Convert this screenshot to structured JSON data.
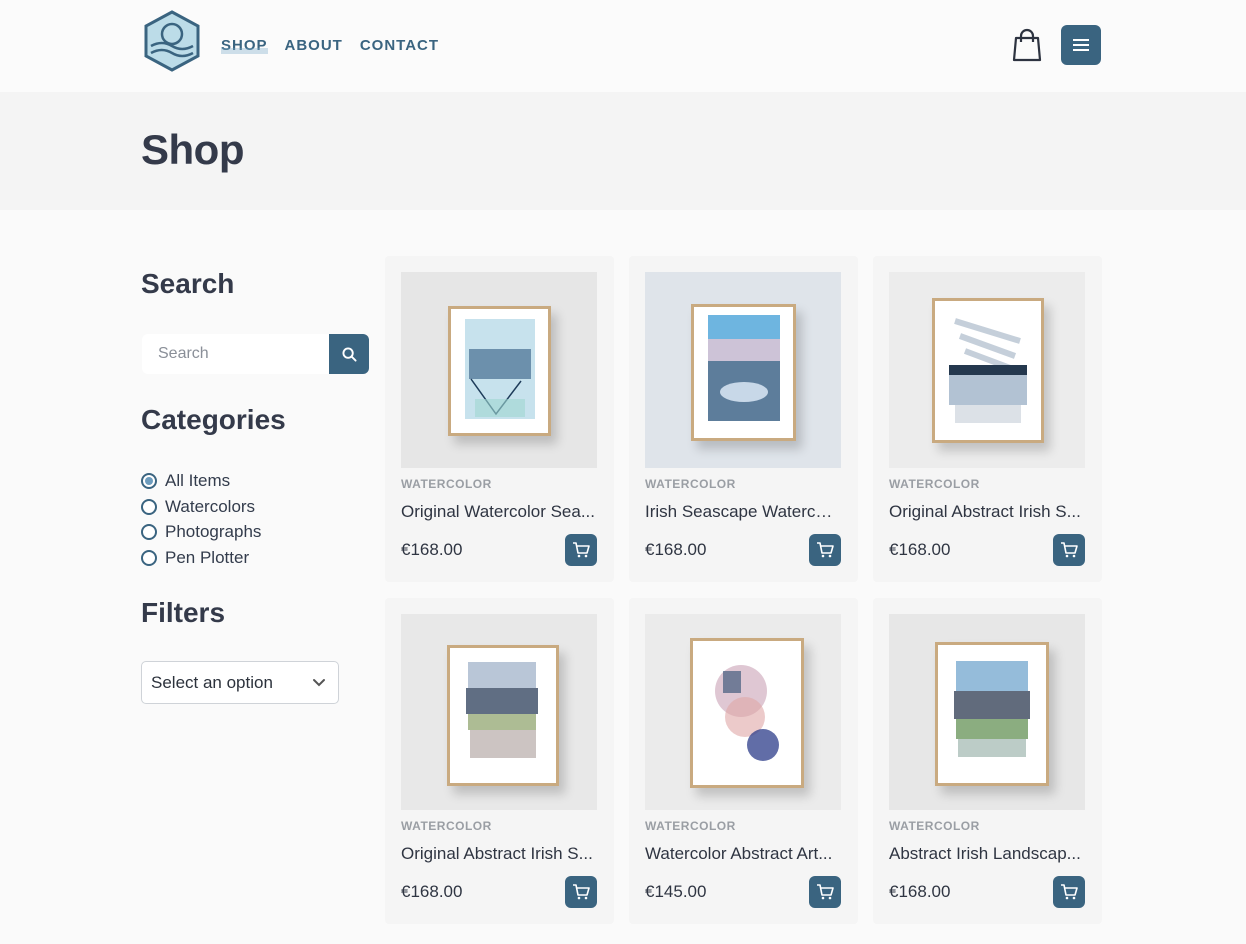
{
  "header": {
    "logo_icon": "landscape-hexagon-logo",
    "nav": [
      "SHOP",
      "ABOUT",
      "CONTACT"
    ],
    "cart_icon": "shopping-bag-icon",
    "menu_icon": "hamburger-menu-icon"
  },
  "page_title": "Shop",
  "sidebar": {
    "search_heading": "Search",
    "search_placeholder": "Search",
    "categories_heading": "Categories",
    "categories": [
      {
        "label": "All Items",
        "checked": true
      },
      {
        "label": "Watercolors",
        "checked": false
      },
      {
        "label": "Photographs",
        "checked": false
      },
      {
        "label": "Pen Plotter",
        "checked": false
      }
    ],
    "filters_heading": "Filters",
    "filter_selected": "Select an option"
  },
  "products": [
    {
      "category": "WATERCOLOR",
      "name": "Original Watercolor Sea...",
      "price": "€168.00"
    },
    {
      "category": "WATERCOLOR",
      "name": "Irish Seascape Watercol...",
      "price": "€168.00"
    },
    {
      "category": "WATERCOLOR",
      "name": "Original Abstract Irish S...",
      "price": "€168.00"
    },
    {
      "category": "WATERCOLOR",
      "name": "Original Abstract Irish S...",
      "price": "€168.00"
    },
    {
      "category": "WATERCOLOR",
      "name": "Watercolor Abstract Art...",
      "price": "€145.00"
    },
    {
      "category": "WATERCOLOR",
      "name": "Abstract Irish Landscap...",
      "price": "€168.00"
    }
  ],
  "colors": {
    "accent": "#3a6480",
    "heading": "#343a4a",
    "frame": "#c9aa80"
  }
}
